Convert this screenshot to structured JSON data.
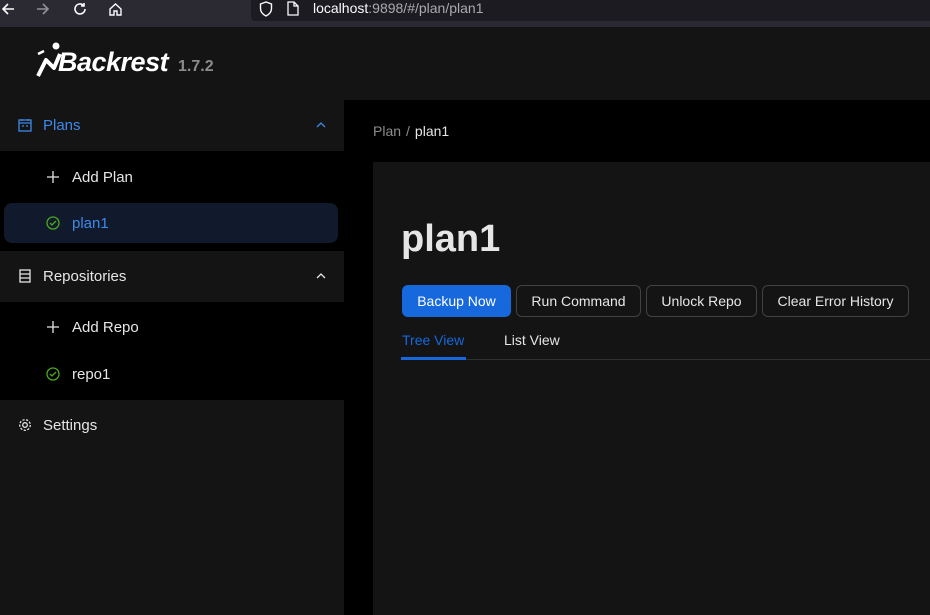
{
  "browser": {
    "url_host": "localhost",
    "url_rest": ":9898/#/plan/plan1"
  },
  "app": {
    "name": "Backrest",
    "version": "1.7.2"
  },
  "sidebar": {
    "plans_section": {
      "label": "Plans",
      "items": [
        {
          "label": "Add Plan",
          "icon": "plus-icon"
        },
        {
          "label": "plan1",
          "icon": "check-circle-icon",
          "selected": true
        }
      ]
    },
    "repos_section": {
      "label": "Repositories",
      "items": [
        {
          "label": "Add Repo",
          "icon": "plus-icon"
        },
        {
          "label": "repo1",
          "icon": "check-circle-icon"
        }
      ]
    },
    "settings_label": "Settings"
  },
  "breadcrumb": {
    "root": "Plan",
    "separator": "/",
    "current": "plan1"
  },
  "plan": {
    "title": "plan1",
    "buttons": {
      "backup_now": "Backup Now",
      "run_command": "Run Command",
      "unlock_repo": "Unlock Repo",
      "clear_error_history": "Clear Error History"
    },
    "tabs": {
      "tree_view": "Tree View",
      "list_view": "List View",
      "active": "Tree View"
    }
  },
  "colors": {
    "accent": "#1668dc",
    "selected_text": "#3c89e8",
    "success": "#49aa19"
  }
}
